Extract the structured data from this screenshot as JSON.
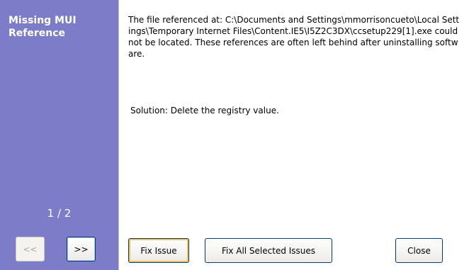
{
  "left_panel": {
    "title": "Missing MUI\nReference",
    "page_counter": "1 / 2",
    "prev_label": "<<",
    "next_label": ">>"
  },
  "content": {
    "description": "The file referenced at: C:\\Documents and Settings\\mmorrisoncueto\\Local Settings\\Temporary Internet Files\\Content.IE5\\I5Z2C3DX\\ccsetup229[1].exe could not be located. These references are often left behind after uninstalling software.",
    "solution": "Solution: Delete the registry value."
  },
  "buttons": {
    "fix_issue": "Fix Issue",
    "fix_all": "Fix All Selected Issues",
    "close": "Close"
  },
  "colors": {
    "panel_background": "#7c7cc8",
    "button_border": "#003c74",
    "focus_highlight": "#f0c060"
  }
}
